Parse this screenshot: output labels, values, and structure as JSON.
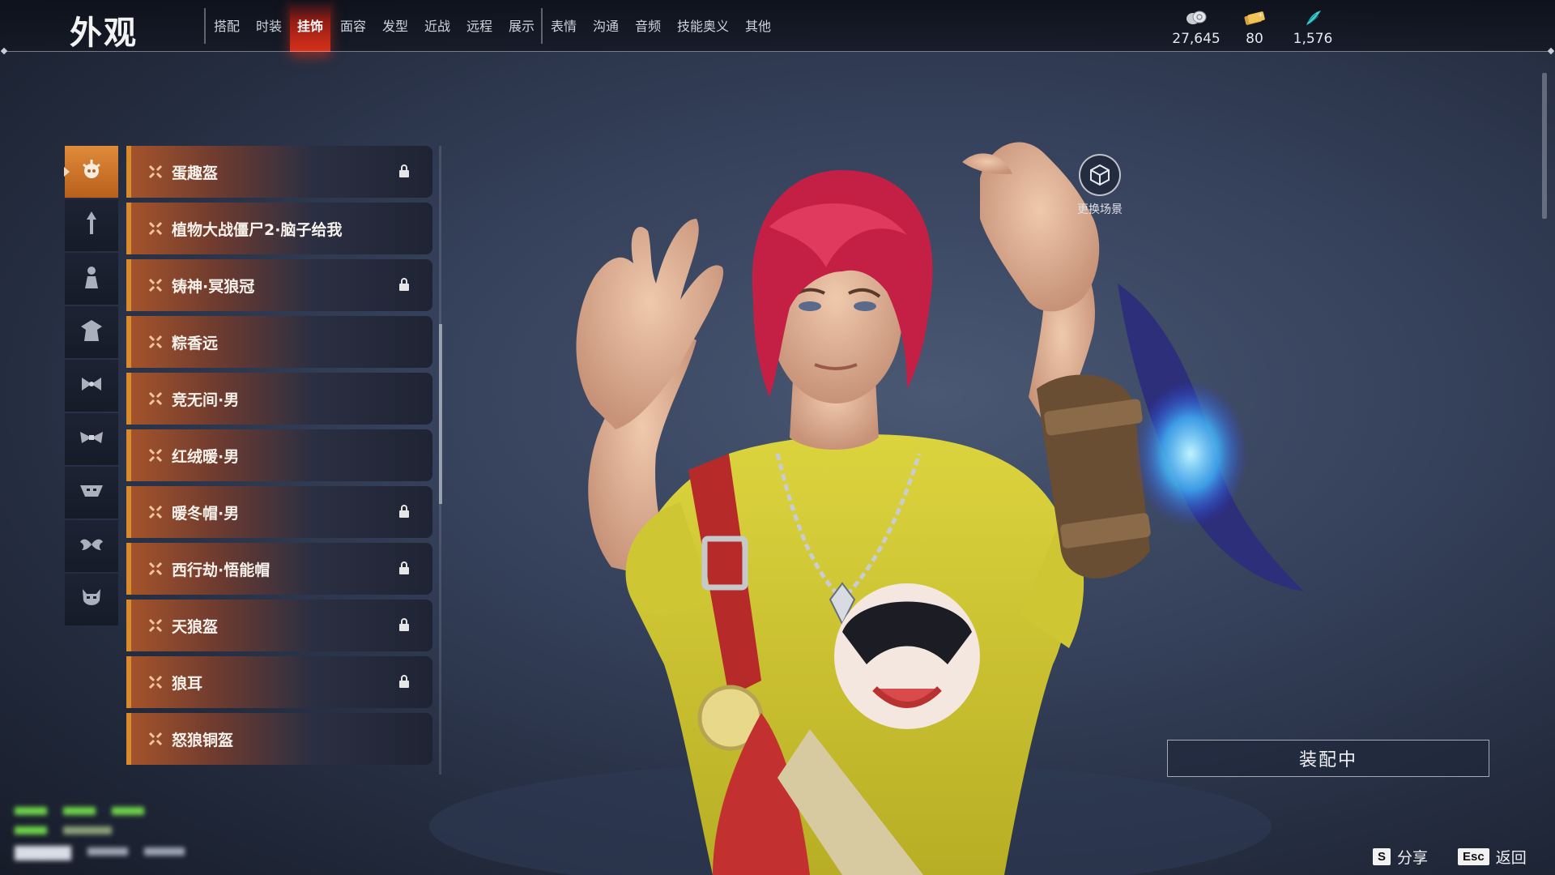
{
  "header": {
    "title": "外观",
    "tabs": [
      {
        "label": "搭配",
        "active": false
      },
      {
        "label": "时装",
        "active": false
      },
      {
        "label": "挂饰",
        "active": true
      },
      {
        "label": "面容",
        "active": false
      },
      {
        "label": "发型",
        "active": false
      },
      {
        "label": "近战",
        "active": false
      },
      {
        "label": "远程",
        "active": false
      },
      {
        "label": "展示",
        "active": false
      },
      {
        "label": "表情",
        "active": false
      },
      {
        "label": "沟通",
        "active": false
      },
      {
        "label": "音频",
        "active": false
      },
      {
        "label": "技能奥义",
        "active": false
      },
      {
        "label": "其他",
        "active": false
      }
    ],
    "currencies": [
      {
        "icon": "coin-icon",
        "value": "27,645"
      },
      {
        "icon": "gold-ticket-icon",
        "value": "80"
      },
      {
        "icon": "feather-token-icon",
        "value": "1,576"
      }
    ]
  },
  "categories": [
    {
      "icon": "head-accessory-icon",
      "active": true
    },
    {
      "icon": "hairpin-icon",
      "active": false
    },
    {
      "icon": "figure-ornament-icon",
      "active": false
    },
    {
      "icon": "cape-icon",
      "active": false
    },
    {
      "icon": "bow-icon",
      "active": false
    },
    {
      "icon": "wide-bow-icon",
      "active": false
    },
    {
      "icon": "mask-icon",
      "active": false
    },
    {
      "icon": "wing-bow-icon",
      "active": false
    },
    {
      "icon": "demon-mask-icon",
      "active": false
    }
  ],
  "items": [
    {
      "name": "蛋趣盔",
      "locked": true
    },
    {
      "name": "植物大战僵尸2·脑子给我",
      "locked": false
    },
    {
      "name": "铸神·冥狼冠",
      "locked": true
    },
    {
      "name": "粽香远",
      "locked": false
    },
    {
      "name": "竞无间·男",
      "locked": false
    },
    {
      "name": "红绒暖·男",
      "locked": false
    },
    {
      "name": "暖冬帽·男",
      "locked": true
    },
    {
      "name": "西行劫·悟能帽",
      "locked": true
    },
    {
      "name": "天狼盔",
      "locked": true
    },
    {
      "name": "狼耳",
      "locked": true
    },
    {
      "name": "怒狼铜盔",
      "locked": false
    }
  ],
  "scene_button": {
    "label": "更换场景",
    "icon": "cube-icon"
  },
  "equip_button": {
    "label": "装配中"
  },
  "hints": [
    {
      "key": "S",
      "label": "分享"
    },
    {
      "key": "Esc",
      "label": "返回"
    }
  ],
  "colors": {
    "accent_orange": "#d98a2c",
    "active_tab_red": "#d8301a",
    "hair_red": "#c42046",
    "shirt_yellow": "#d6cf3a"
  }
}
